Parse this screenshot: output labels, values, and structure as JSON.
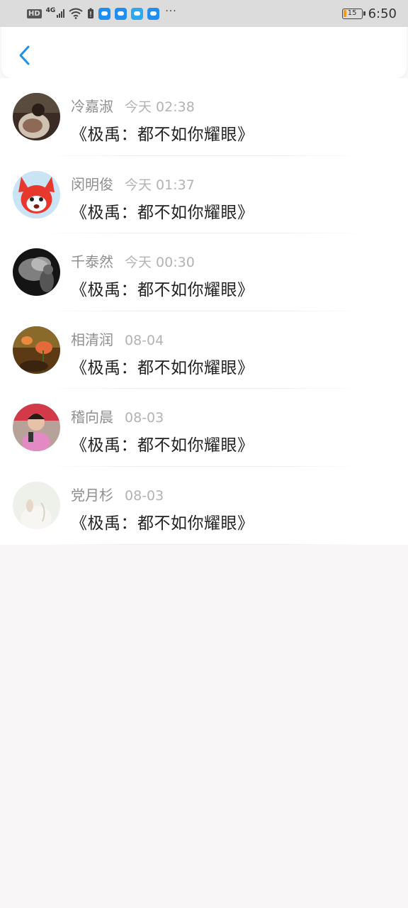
{
  "status_bar": {
    "hd": "HD",
    "network": "4G",
    "battery": "15",
    "time": "6:50",
    "more": "···"
  },
  "icons": {
    "back": "chevron-left-icon"
  },
  "colors": {
    "accent": "#1e90e8",
    "background": "#f8f6f7"
  },
  "items": [
    {
      "name": "冷嘉淑",
      "time": "今天 02:38",
      "title": "《极禹：都不如你耀眼》"
    },
    {
      "name": "闵明俊",
      "time": "今天 01:37",
      "title": "《极禹：都不如你耀眼》"
    },
    {
      "name": "千泰然",
      "time": "今天 00:30",
      "title": "《极禹：都不如你耀眼》"
    },
    {
      "name": "相清润",
      "time": "08-04",
      "title": "《极禹：都不如你耀眼》"
    },
    {
      "name": "稽向晨",
      "time": "08-03",
      "title": "《极禹：都不如你耀眼》"
    },
    {
      "name": "党月杉",
      "time": "08-03",
      "title": "《极禹：都不如你耀眼》"
    }
  ]
}
